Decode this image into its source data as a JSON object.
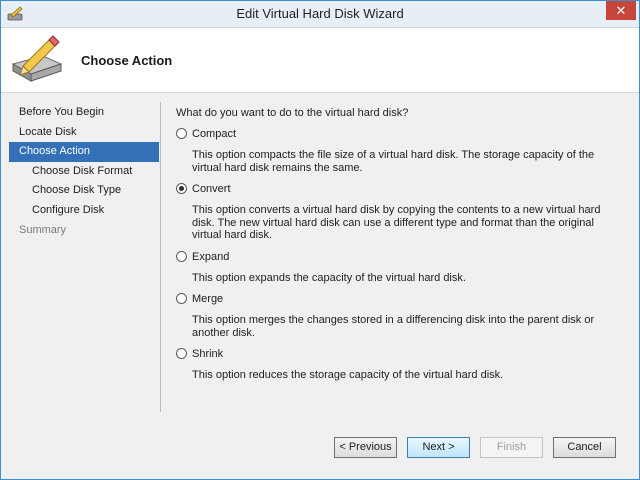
{
  "window": {
    "title": "Edit Virtual Hard Disk Wizard",
    "close_glyph": "✕"
  },
  "header": {
    "title": "Choose Action",
    "icon": "hard-disk-pencil-icon"
  },
  "nav": {
    "items": [
      {
        "label": "Before You Begin"
      },
      {
        "label": "Locate Disk"
      },
      {
        "label": "Choose Action"
      },
      {
        "label": "Choose Disk Format"
      },
      {
        "label": "Choose Disk Type"
      },
      {
        "label": "Configure Disk"
      },
      {
        "label": "Summary"
      }
    ],
    "active": "Choose Action"
  },
  "main": {
    "question": "What do you want to do to the virtual hard disk?",
    "options": [
      {
        "label": "Compact",
        "selected": false,
        "description": "This option compacts the file size of a virtual hard disk. The storage capacity of the virtual hard disk remains the same."
      },
      {
        "label": "Convert",
        "selected": true,
        "description": "This option converts a virtual hard disk by copying the contents to a new virtual hard disk. The new virtual hard disk can use a different type and format than the original virtual hard disk."
      },
      {
        "label": "Expand",
        "selected": false,
        "description": "This option expands the capacity of the virtual hard disk."
      },
      {
        "label": "Merge",
        "selected": false,
        "description": "This option merges the changes stored in a differencing disk into the parent disk or another disk."
      },
      {
        "label": "Shrink",
        "selected": false,
        "description": "This option reduces the storage capacity of the virtual hard disk."
      }
    ]
  },
  "buttons": {
    "previous": "< Previous",
    "next": "Next >",
    "finish": "Finish",
    "cancel": "Cancel"
  }
}
